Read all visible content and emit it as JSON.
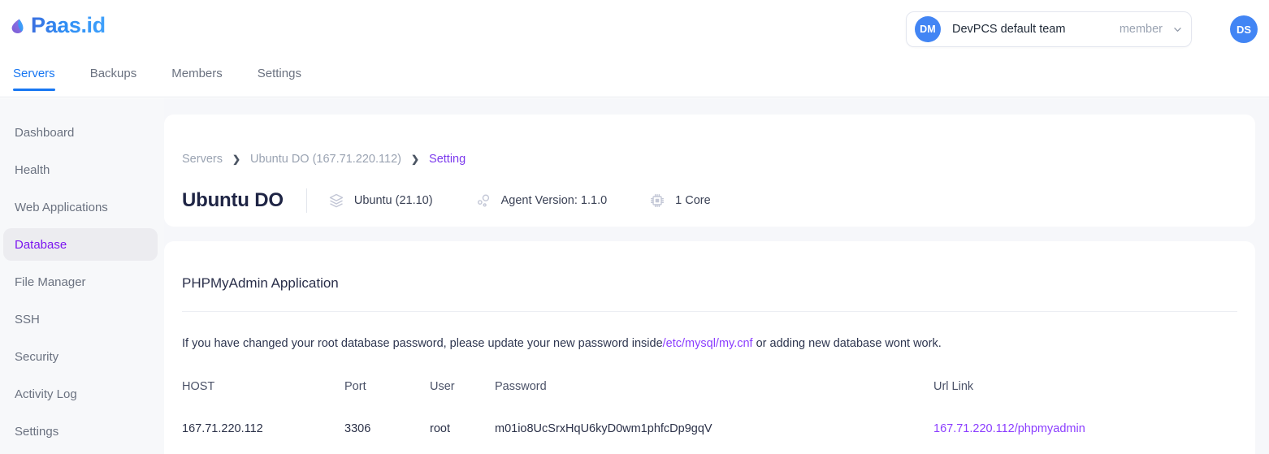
{
  "brand": {
    "name": "Paas.id",
    "logo_icon": "paas-teardrop-logo",
    "accent_blue": "#1877f2",
    "accent_purple": "#8b3dff"
  },
  "header": {
    "team": {
      "avatar_initials": "DM",
      "name": "DevPCS default team",
      "role": "member",
      "caret_icon": "chevron-down-icon"
    },
    "user": {
      "avatar_initials": "DS"
    }
  },
  "tabs": [
    {
      "label": "Servers",
      "active": true
    },
    {
      "label": "Backups",
      "active": false
    },
    {
      "label": "Members",
      "active": false
    },
    {
      "label": "Settings",
      "active": false
    }
  ],
  "sidebar": {
    "items": [
      {
        "label": "Dashboard",
        "active": false
      },
      {
        "label": "Health",
        "active": false
      },
      {
        "label": "Web Applications",
        "active": false
      },
      {
        "label": "Database",
        "active": true
      },
      {
        "label": "File Manager",
        "active": false
      },
      {
        "label": "SSH",
        "active": false
      },
      {
        "label": "Security",
        "active": false
      },
      {
        "label": "Activity Log",
        "active": false
      },
      {
        "label": "Settings",
        "active": false
      }
    ]
  },
  "breadcrumb": {
    "items": [
      {
        "label": "Servers",
        "current": false
      },
      {
        "label": "Ubuntu DO (167.71.220.112)",
        "current": false
      },
      {
        "label": "Setting",
        "current": true
      }
    ],
    "separator": "❯"
  },
  "server": {
    "title": "Ubuntu DO",
    "meta": [
      {
        "icon": "layers-icon",
        "text": "Ubuntu (21.10)"
      },
      {
        "icon": "agent-circles-icon",
        "text": "Agent Version: 1.1.0"
      },
      {
        "icon": "cpu-chip-icon",
        "text": "1 Core"
      }
    ]
  },
  "main": {
    "title": "PHPMyAdmin Application",
    "notice": {
      "before": "If you have changed your root database password, please update your new password inside",
      "path": "/etc/mysql/my.cnf",
      "after": " or adding new database wont work."
    },
    "table": {
      "columns": [
        "HOST",
        "Port",
        "User",
        "Password",
        "Url Link"
      ],
      "rows": [
        {
          "host": "167.71.220.112",
          "port": "3306",
          "user": "root",
          "password": "m01io8UcSrxHqU6kyD0wm1phfcDp9gqV",
          "url": "167.71.220.112/phpmyadmin"
        }
      ]
    }
  }
}
